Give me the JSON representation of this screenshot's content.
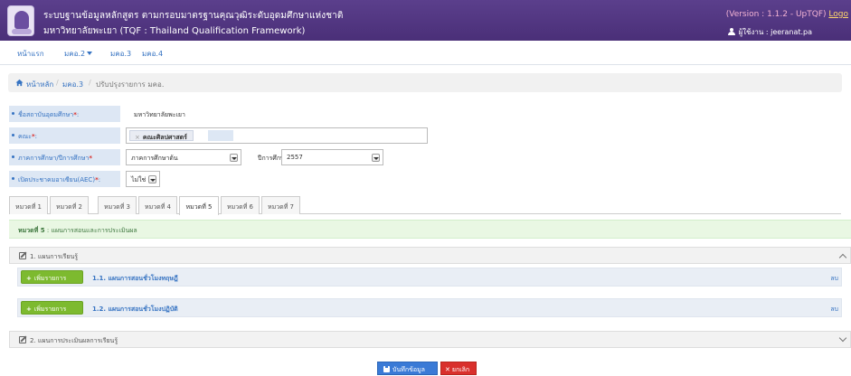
{
  "header": {
    "title_th": "ระบบฐานข้อมูลหลักสูตร ตามกรอบมาตรฐานคุณวุฒิระดับอุดมศึกษาแห่งชาติ",
    "title_sub": "มหาวิทยาลัยพะเยา (TQF : Thailand Qualification Framework)",
    "version": "(Version : 1.1.2 - UpTQF)",
    "logout": "Logo",
    "user": "ผู้ใช้งาน : jeeranat.pa"
  },
  "menu": {
    "home": "หน้าแรก",
    "mko2": "มคอ.2",
    "mko3": "มคอ.3",
    "mko4": "มคอ.4"
  },
  "breadcrumb": {
    "home": "หน้าหลัก",
    "sep1": "/",
    "mko3": "มคอ.3",
    "sep2": "/",
    "current": "ปรับปรุงรายการ มคอ."
  },
  "form": {
    "institution_label": "ชื่อสถาบันอุดมศึกษา",
    "institution_value": "มหาวิทยาลัยพะเยา",
    "faculty_label": "คณะ",
    "faculty_tag": "คณะศิลปศาสตร์",
    "faculty_tag_remove": "×",
    "semester_label": "ภาคการศึกษา/ปีการศึกษา",
    "semester_value": "ภาคการศึกษาต้น",
    "year_label": "ปีการศึกษา",
    "year_value": "2557",
    "aec_label": "เปิดประชาคมอาเซียน(AEC)",
    "aec_value": "ไม่ใช่",
    "required_mark": "*",
    "colon": ":"
  },
  "tabs": [
    {
      "label": "หมวดที่ 1"
    },
    {
      "label": "หมวดที่ 2"
    },
    {
      "label": "หมวดที่ 3"
    },
    {
      "label": "หมวดที่ 4"
    },
    {
      "label": "หมวดที่ 5"
    },
    {
      "label": "หมวดที่ 6"
    },
    {
      "label": "หมวดที่ 7"
    }
  ],
  "active_tab_index": 4,
  "section": {
    "title": "หมวดที่ 5",
    "desc": ": แผนการสอนและการประเมินผล"
  },
  "panels": {
    "p1_title": "1. แผนการเรียนรู้",
    "sub1_add": "เพิ่มรายการ",
    "sub1_title": "1.1. แผนการสอนชั่วโมงทฤษฎี",
    "sub1_del": "ลบ",
    "sub2_add": "เพิ่มรายการ",
    "sub2_title": "1.2. แผนการสอนชั่วโมงปฏิบัติ",
    "sub2_del": "ลบ",
    "p2_title": "2. แผนการประเมินผลการเรียนรู้"
  },
  "footer": {
    "save": "บันทึกข้อมูล",
    "cancel": "ยกเลิก"
  },
  "colors": {
    "header_bg": "#4a2f78",
    "link": "#3673c2",
    "label_bg": "#dde7f4",
    "alert_bg": "#e9f7e3",
    "add_btn": "#7dba2f",
    "save_btn": "#3a7ad6",
    "cancel_btn": "#d9302c"
  }
}
